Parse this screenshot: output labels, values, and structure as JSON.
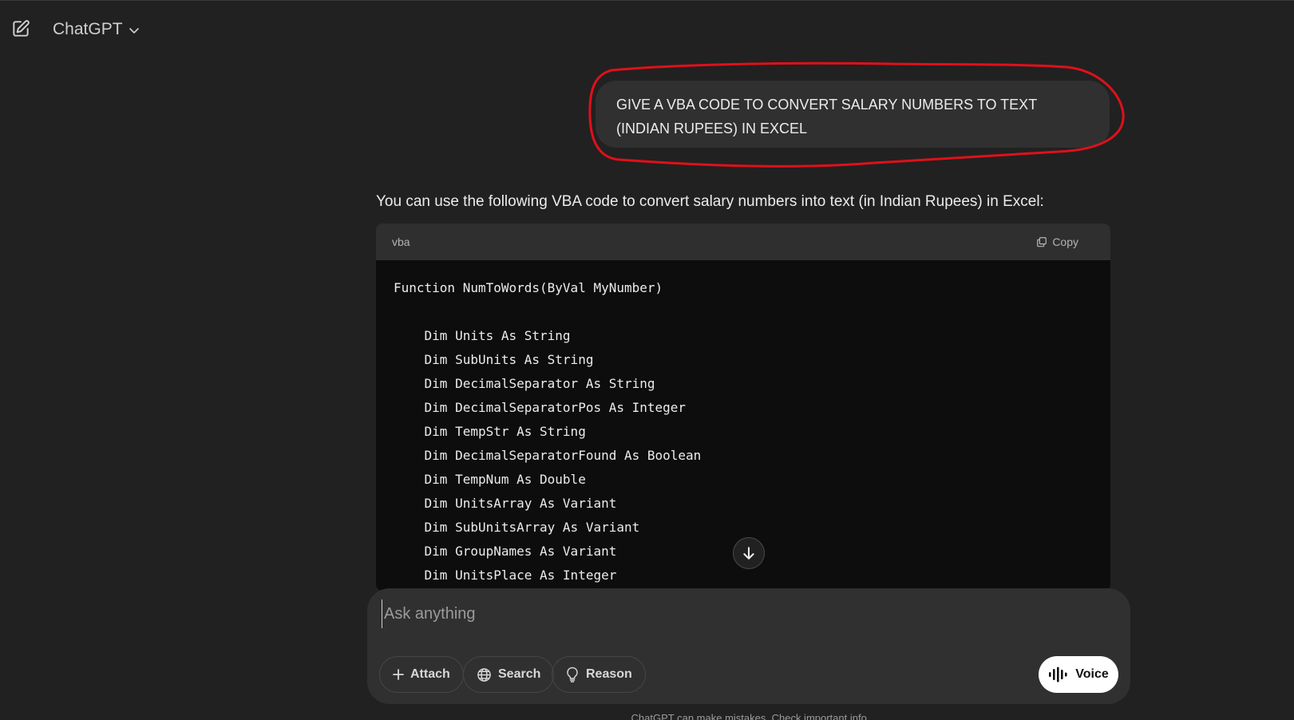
{
  "header": {
    "title": "ChatGPT",
    "new_chat_icon": "edit-icon",
    "model_menu_icon": "chevron-down-icon"
  },
  "conversation": {
    "user_message": {
      "line1": "GIVE A VBA CODE TO CONVERT SALARY NUMBERS TO TEXT",
      "line2": "(INDIAN RUPEES) IN EXCEL",
      "annotation_color": "#e0101a"
    },
    "assistant": {
      "intro": "You can use the following VBA code to convert salary numbers into text (in Indian Rupees) in Excel:",
      "code_block": {
        "language": "vba",
        "copy_label": "Copy",
        "lines": [
          "Function NumToWords(ByVal MyNumber)",
          "",
          "    Dim Units As String",
          "    Dim SubUnits As String",
          "    Dim DecimalSeparator As String",
          "    Dim DecimalSeparatorPos As Integer",
          "    Dim TempStr As String",
          "    Dim DecimalSeparatorFound As Boolean",
          "    Dim TempNum As Double",
          "    Dim UnitsArray As Variant",
          "    Dim SubUnitsArray As Variant",
          "    Dim GroupNames As Variant",
          "    Dim UnitsPlace As Integer"
        ]
      }
    }
  },
  "composer": {
    "placeholder": "Ask anything",
    "attach_label": "Attach",
    "search_label": "Search",
    "reason_label": "Reason",
    "voice_label": "Voice"
  },
  "footer": {
    "disclaimer": "ChatGPT can make mistakes. Check important info."
  }
}
